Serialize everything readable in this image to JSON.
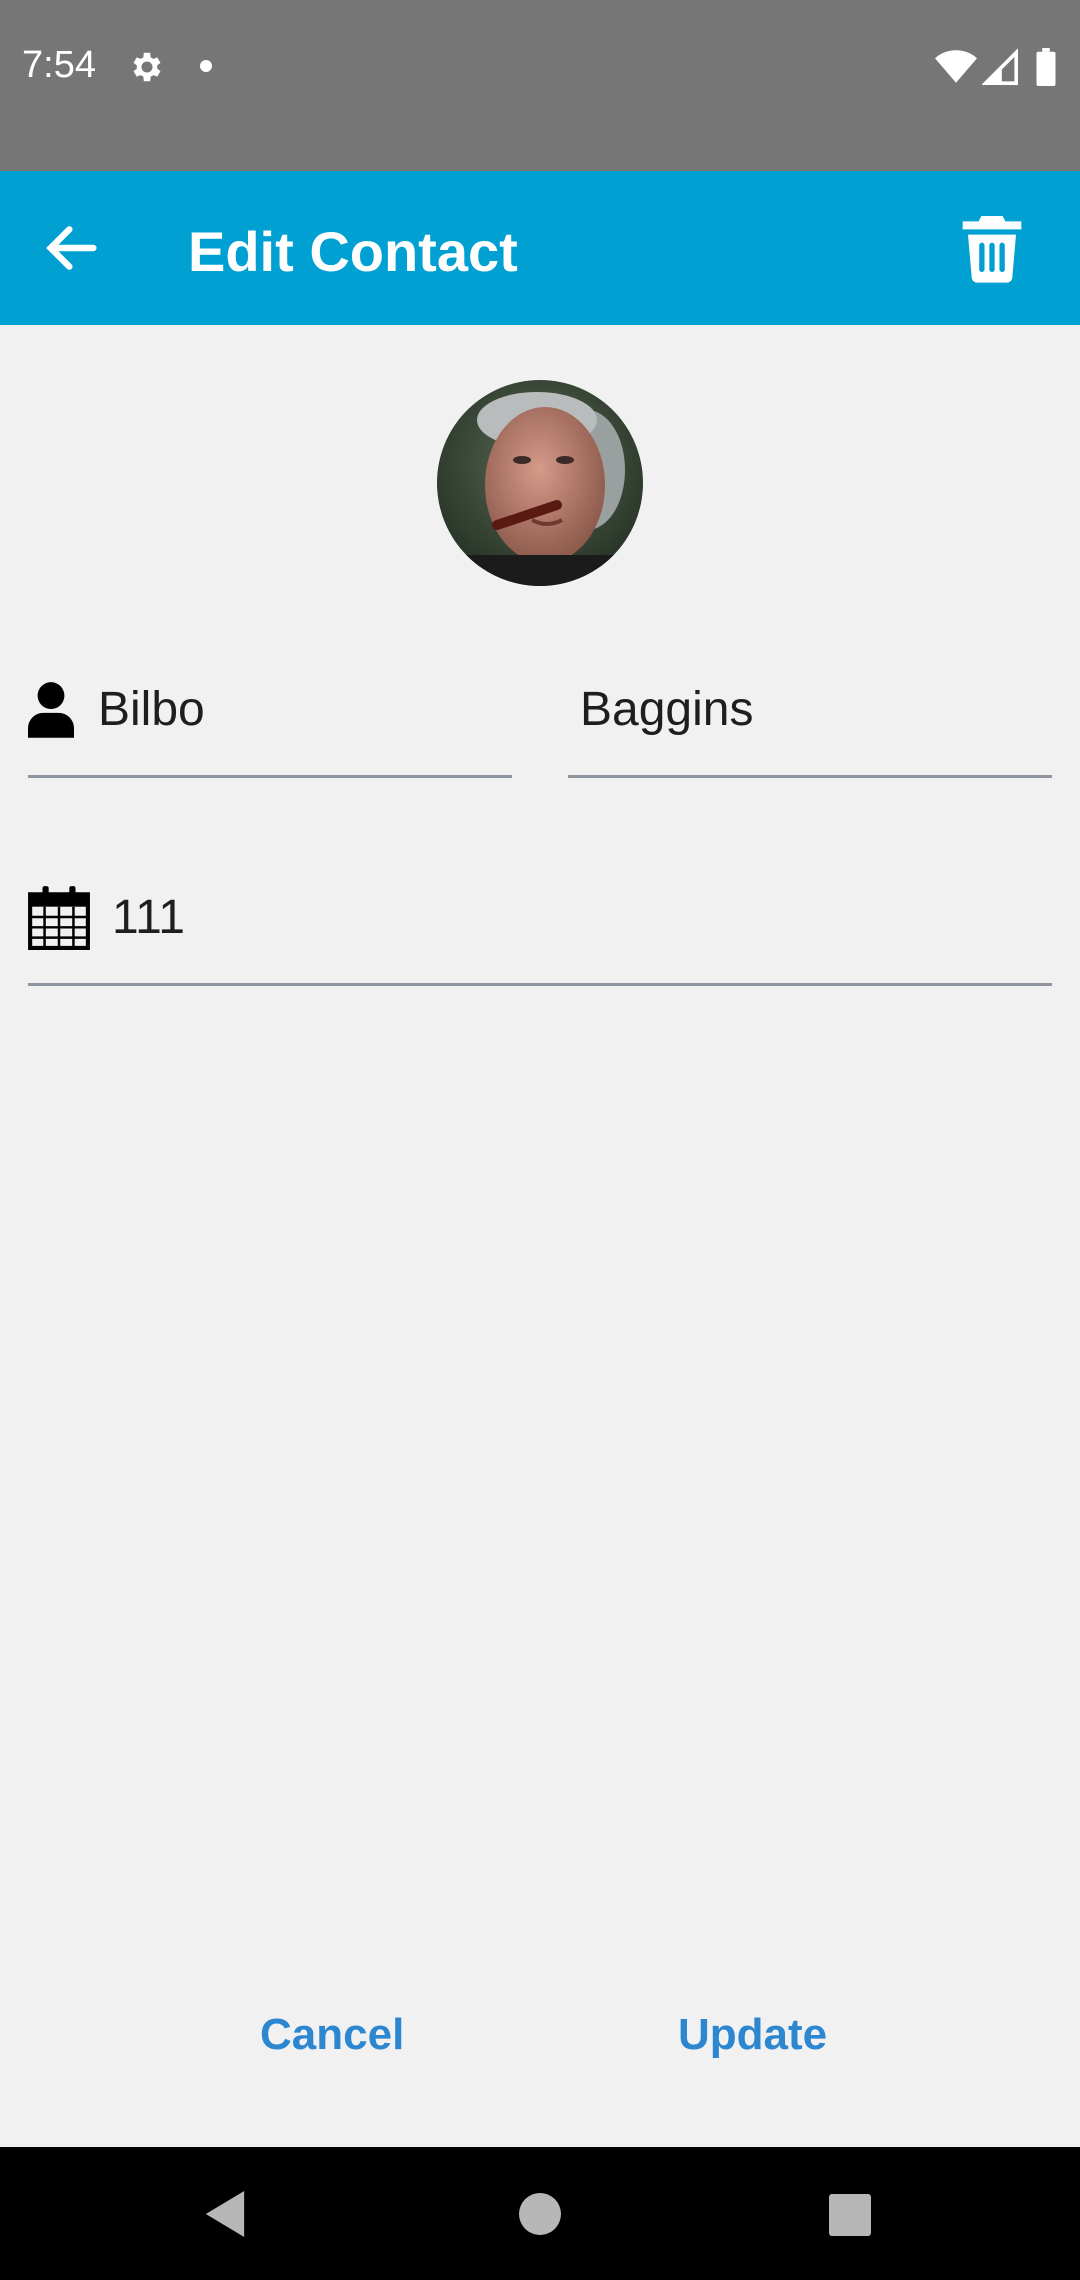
{
  "status_bar": {
    "time": "7:54",
    "icons": [
      "settings-icon",
      "notification-dot-icon",
      "wifi-icon",
      "signal-icon",
      "battery-icon"
    ]
  },
  "app_bar": {
    "title": "Edit Contact",
    "back_icon": "arrow-left-icon",
    "delete_icon": "trash-icon",
    "background_color": "#00a0d2"
  },
  "contact": {
    "first_name": "Bilbo",
    "last_name": "Baggins",
    "phone": "111",
    "name_icon": "person-icon",
    "phone_icon": "calendar-icon"
  },
  "actions": {
    "cancel_label": "Cancel",
    "update_label": "Update",
    "accent_color": "#2c86d0"
  },
  "nav_bar": {
    "icons": [
      "nav-back-icon",
      "nav-home-icon",
      "nav-recents-icon"
    ]
  }
}
